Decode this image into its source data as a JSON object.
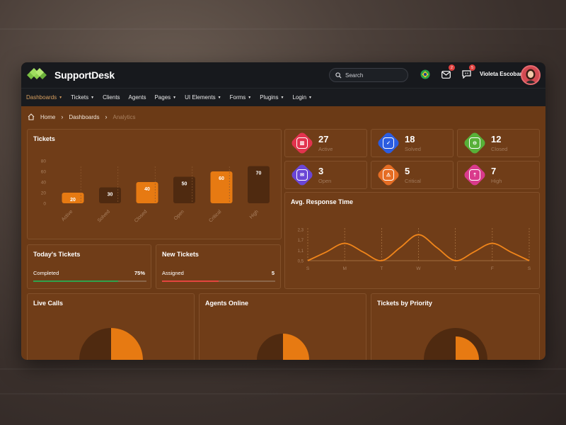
{
  "app": {
    "name": "SupportDesk"
  },
  "header": {
    "search_label": "Search",
    "user_name": "Violeta Escobar",
    "mail_badge": "2",
    "chat_badge": "5"
  },
  "nav": [
    {
      "label": "Dashboards",
      "active": true,
      "caret": true
    },
    {
      "label": "Tickets",
      "caret": true
    },
    {
      "label": "Clients",
      "caret": false
    },
    {
      "label": "Agents",
      "caret": false
    },
    {
      "label": "Pages",
      "caret": true
    },
    {
      "label": "UI Elements",
      "caret": true
    },
    {
      "label": "Forms",
      "caret": true
    },
    {
      "label": "Plugins",
      "caret": true
    },
    {
      "label": "Login",
      "caret": true
    }
  ],
  "breadcrumb": {
    "home": "Home",
    "parent": "Dashboards",
    "current": "Analytics"
  },
  "tickets_panel": {
    "title": "Tickets"
  },
  "stats": [
    {
      "value": "27",
      "label": "Active",
      "color": "#e2334e",
      "glyph": "▥"
    },
    {
      "value": "18",
      "label": "Solved",
      "color": "#2b5ce0",
      "glyph": "✓"
    },
    {
      "value": "12",
      "label": "Closed",
      "color": "#57b038",
      "glyph": "⊖"
    },
    {
      "value": "3",
      "label": "Open",
      "color": "#6a46d6",
      "glyph": "✉"
    },
    {
      "value": "5",
      "label": "Critical",
      "color": "#e56d24",
      "glyph": "⚠"
    },
    {
      "value": "7",
      "label": "High",
      "color": "#d93a8c",
      "glyph": "⇡"
    }
  ],
  "today_tickets": {
    "title": "Today's Tickets",
    "label": "Completed",
    "value": "75%",
    "progress": 0.75,
    "color": "#2fa34c"
  },
  "new_tickets": {
    "title": "New Tickets",
    "label": "Assigned",
    "value": "5",
    "progress": 0.5,
    "color": "#e2453f"
  },
  "response_panel": {
    "title": "Avg. Response Time"
  },
  "live_calls": {
    "title": "Live Calls"
  },
  "agents_online": {
    "title": "Agents Online"
  },
  "tickets_priority": {
    "title": "Tickets by Priority"
  },
  "chart_data": [
    {
      "type": "bar",
      "categories": [
        "Active",
        "Solved",
        "Closed",
        "Open",
        "Critical",
        "High"
      ],
      "values": [
        20,
        30,
        40,
        50,
        60,
        70
      ],
      "highlight": [
        true,
        false,
        true,
        false,
        true,
        false
      ],
      "yticks": [
        0,
        20,
        40,
        60,
        80
      ],
      "ylim": [
        0,
        80
      ],
      "highlight_color": "#e77a12",
      "base_color": "#4f2a10"
    },
    {
      "type": "line",
      "categories": [
        "S",
        "M",
        "T",
        "W",
        "T",
        "F",
        "S"
      ],
      "yticks": [
        "0,5",
        "1,1",
        "1,7",
        "2,3"
      ],
      "x": [
        0,
        0.5,
        1,
        1.5,
        2,
        2.5,
        3,
        3.5,
        4,
        4.5,
        5,
        5.5,
        6
      ],
      "values": [
        0.5,
        1.0,
        1.5,
        1.0,
        0.5,
        1.25,
        2.0,
        1.25,
        0.5,
        1.0,
        1.5,
        1.0,
        0.5
      ],
      "ylim": [
        0.5,
        2.3
      ],
      "color": "#f0851a"
    }
  ]
}
